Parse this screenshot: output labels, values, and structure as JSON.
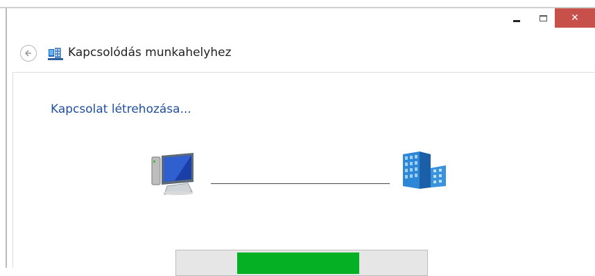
{
  "window": {
    "close_glyph": "✕"
  },
  "nav": {
    "title": "Kapcsolódás munkahelyhez",
    "icons": [
      "back-arrow-icon",
      "workplace-network-icon"
    ]
  },
  "main": {
    "heading": "Kapcsolat létrehozása...",
    "left_icon": "computer-icon",
    "right_icon": "office-building-icon"
  },
  "progress": {
    "style": "indeterminate-marquee",
    "fill_color": "#06b025"
  },
  "colors": {
    "heading": "#1f4e9e",
    "close_button": "#c7504b"
  }
}
